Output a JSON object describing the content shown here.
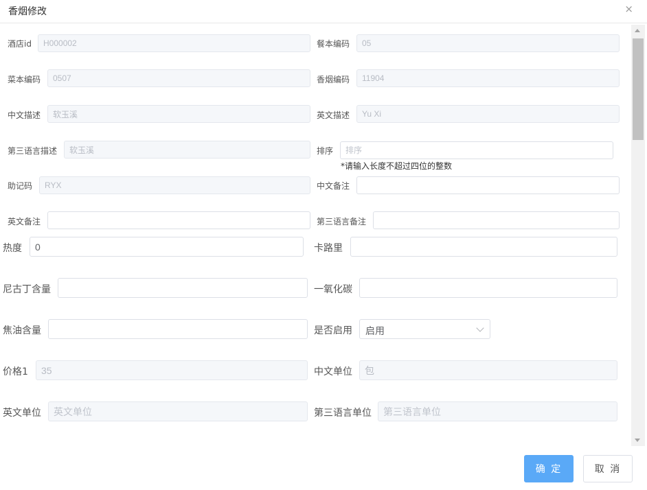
{
  "dialog": {
    "title": "香烟修改",
    "close": "×"
  },
  "fields": {
    "hotel_id": {
      "label": "酒店id",
      "value": "H000002"
    },
    "menu_code": {
      "label": "餐本编码",
      "value": "05"
    },
    "dish_code": {
      "label": "菜本编码",
      "value": "0507"
    },
    "cigarette_code": {
      "label": "香烟编码",
      "value": "11904"
    },
    "cn_desc": {
      "label": "中文描述",
      "value": "软玉溪"
    },
    "en_desc": {
      "label": "英文描述",
      "value": "Yu Xi"
    },
    "third_desc": {
      "label": "第三语言描述",
      "value": "软玉溪"
    },
    "sort": {
      "label": "排序",
      "placeholder": "排序",
      "hint": "*请输入长度不超过四位的整数"
    },
    "mnemonic": {
      "label": "助记码",
      "value": "RYX"
    },
    "cn_note": {
      "label": "中文备注",
      "value": ""
    },
    "en_note": {
      "label": "英文备注",
      "value": ""
    },
    "third_note": {
      "label": "第三语言备注",
      "value": ""
    },
    "heat": {
      "label": "热度",
      "value": "0"
    },
    "calorie": {
      "label": "卡路里",
      "value": ""
    },
    "nicotine": {
      "label": "尼古丁含量",
      "value": ""
    },
    "co": {
      "label": "一氧化碳",
      "value": ""
    },
    "tar": {
      "label": "焦油含量",
      "value": ""
    },
    "enabled": {
      "label": "是否启用",
      "value": "启用"
    },
    "price1": {
      "label": "价格1",
      "value": "35"
    },
    "cn_unit": {
      "label": "中文单位",
      "value": "包"
    },
    "en_unit": {
      "label": "英文单位",
      "placeholder": "英文单位"
    },
    "third_unit": {
      "label": "第三语言单位",
      "placeholder": "第三语言单位"
    }
  },
  "buttons": {
    "ok": "确 定",
    "cancel": "取 消"
  },
  "scroll": {
    "position_fraction": 0.0
  },
  "colors": {
    "primary": "#5aa9f7",
    "disabled_bg": "#f5f7fa",
    "border": "#dcdfe6"
  }
}
